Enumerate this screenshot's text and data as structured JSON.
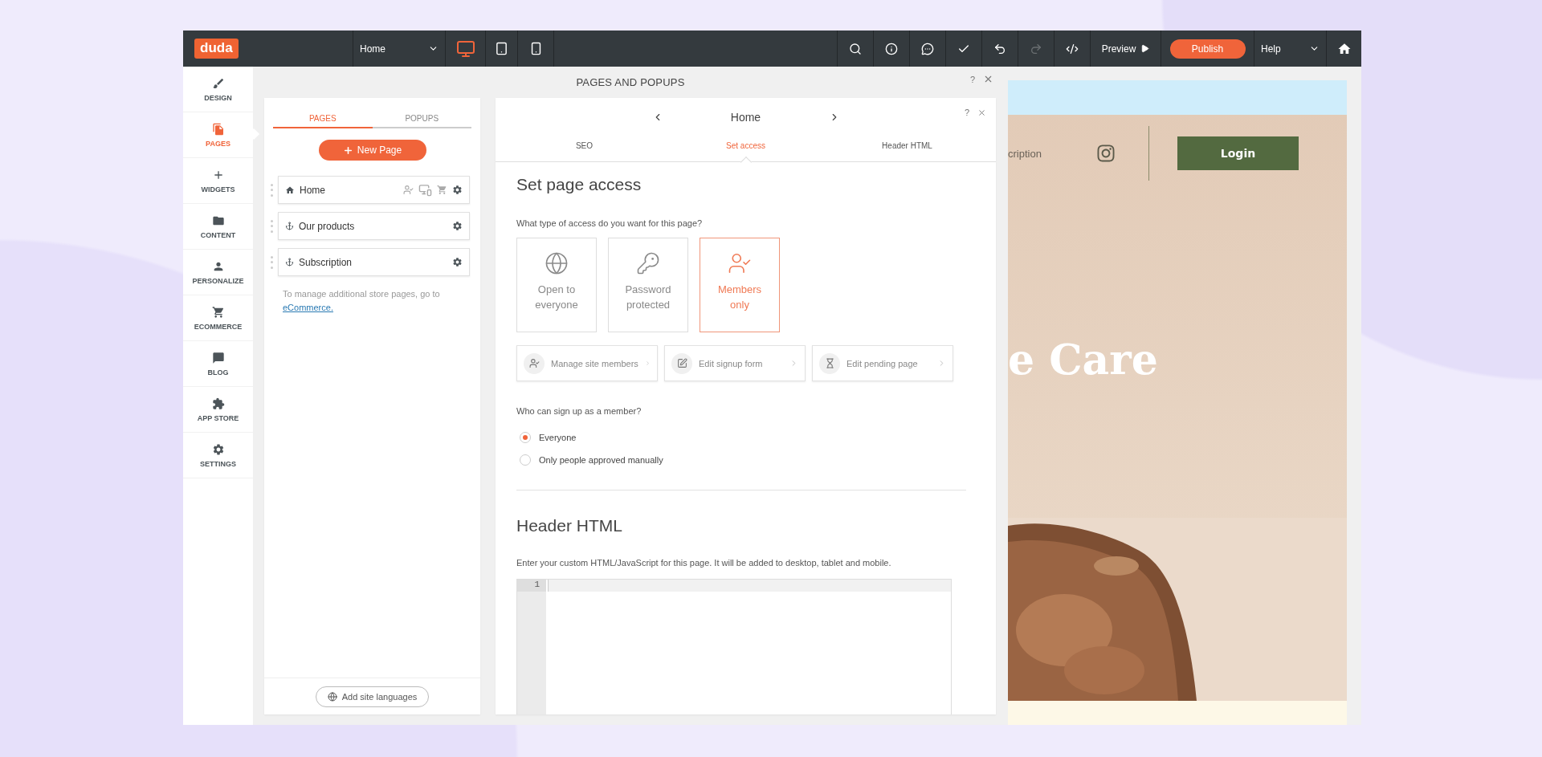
{
  "topbar": {
    "logo": "duda",
    "page_select": "Home",
    "devices": [
      {
        "kind": "desktop",
        "selected": true
      },
      {
        "kind": "tablet",
        "selected": false
      },
      {
        "kind": "mobile",
        "selected": false
      }
    ],
    "tools": [
      {
        "kind": "search",
        "disabled": false
      },
      {
        "kind": "info",
        "disabled": false
      },
      {
        "kind": "comments",
        "disabled": false
      },
      {
        "kind": "check",
        "disabled": false
      },
      {
        "kind": "undo",
        "disabled": false
      },
      {
        "kind": "redo",
        "disabled": true
      },
      {
        "kind": "code",
        "disabled": false
      }
    ],
    "preview": "Preview",
    "publish": "Publish",
    "help": "Help"
  },
  "sidebar": {
    "items": [
      {
        "kind": "design",
        "label": "DESIGN",
        "selected": false
      },
      {
        "kind": "pages",
        "label": "PAGES",
        "selected": true
      },
      {
        "kind": "widgets",
        "label": "WIDGETS",
        "selected": false
      },
      {
        "kind": "content",
        "label": "CONTENT",
        "selected": false
      },
      {
        "kind": "personalize",
        "label": "PERSONALIZE",
        "selected": false
      },
      {
        "kind": "ecommerce",
        "label": "ECOMMERCE",
        "selected": false
      },
      {
        "kind": "blog",
        "label": "BLOG",
        "selected": false
      },
      {
        "kind": "appstore",
        "label": "APP STORE",
        "selected": false
      },
      {
        "kind": "settings",
        "label": "SETTINGS",
        "selected": false
      }
    ]
  },
  "panel": {
    "title": "PAGES AND POPUPS",
    "help": "?",
    "tabs": [
      {
        "label": "PAGES",
        "selected": true
      },
      {
        "label": "POPUPS",
        "selected": false
      }
    ],
    "new_page": "New Page",
    "pages": [
      {
        "kind": "home",
        "name": "Home"
      },
      {
        "kind": "anchor",
        "name": "Our products"
      },
      {
        "kind": "anchor",
        "name": "Subscription"
      }
    ],
    "note": "To manage additional store pages, go to",
    "note_link": "eCommerce.",
    "languages": "Add site languages"
  },
  "settings": {
    "page": "Home",
    "help": "?",
    "tabs": [
      {
        "label": "SEO",
        "selected": false
      },
      {
        "label": "Set access",
        "selected": true
      },
      {
        "label": "Header HTML",
        "selected": false
      }
    ],
    "heading": "Set page access",
    "question": "What type of access do you want for this page?",
    "access_options": [
      {
        "kind": "open",
        "label": "Open to everyone",
        "selected": false
      },
      {
        "kind": "password",
        "label": "Password protected",
        "selected": false
      },
      {
        "kind": "members",
        "label": "Members only",
        "selected": true
      }
    ],
    "actions": [
      {
        "kind": "members",
        "label": "Manage site members"
      },
      {
        "kind": "signup",
        "label": "Edit signup form"
      },
      {
        "kind": "pending",
        "label": "Edit pending page"
      }
    ],
    "signup_question": "Who can sign up as a member?",
    "signup_options": [
      {
        "label": "Everyone",
        "selected": true
      },
      {
        "label": "Only people approved manually",
        "selected": false
      }
    ],
    "header_heading": "Header HTML",
    "header_description": "Enter your custom HTML/JavaScript for this page. It will be added to desktop, tablet and mobile.",
    "editor": {
      "line_numbers": [
        "1"
      ]
    }
  },
  "preview": {
    "nav_link": "cription",
    "login": "Login",
    "headline": "e Care"
  }
}
